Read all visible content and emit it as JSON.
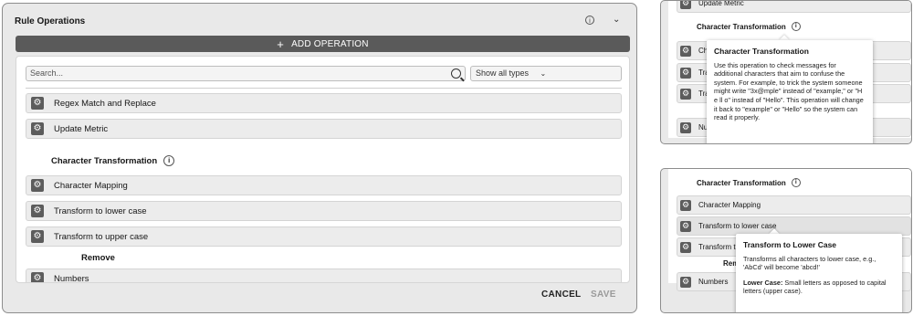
{
  "main": {
    "title": "Rule Operations",
    "add_operation": "ADD OPERATION",
    "search_placeholder": "Search...",
    "filter_value": "Show all types",
    "items_top": [
      "Regex Match and Replace",
      "Update Metric"
    ],
    "section_char_transform": "Character Transformation",
    "items_char": [
      "Character Mapping",
      "Transform to lower case",
      "Transform to upper case"
    ],
    "section_remove": "Remove",
    "items_remove": [
      "Numbers"
    ],
    "cancel": "CANCEL",
    "save": "SAVE"
  },
  "side_top": {
    "clipped_row": "Update Metric",
    "section_title": "Character Transformation",
    "rows": [
      "Cha",
      "Tra",
      "Tra",
      "Nu"
    ],
    "tooltip_title": "Character Transformation",
    "tooltip_body": "Use this operation to check messages for additional characters that aim to confuse the system.  For example, to trick the system someone might write \"3x@mple\" instead of \"example,\"  or \"H e ll o\"  instead of \"Hello\". This operation will change it back to \"example\" or \"Hello\" so the system can read it properly."
  },
  "side_bottom": {
    "section_title": "Character Transformation",
    "rows": [
      "Character Mapping",
      "Transform to lower case",
      "Transform to",
      "Numbers"
    ],
    "remove_label": "Remo",
    "tooltip_title": "Transform to Lower Case",
    "tooltip_body": "Transforms all characters to lower case, e.g., 'AbCd' will become 'abcd!'",
    "tooltip_term": "Lower Case:",
    "tooltip_def": "Small letters as opposed to capital letters (upper case)."
  },
  "icons": {
    "gear": "gear-icon",
    "info": "info-icon",
    "search": "search-icon",
    "chevron": "chevron-down-icon",
    "plus": "plus-icon"
  }
}
